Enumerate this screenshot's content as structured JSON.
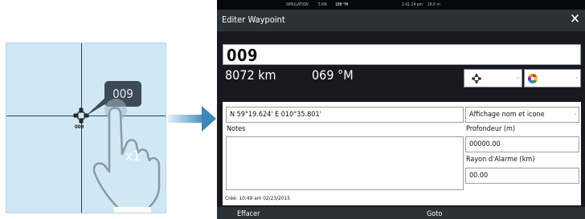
{
  "status_bar": {
    "mode": "SIMULATION",
    "speed": "5 KN",
    "heading": "188 °M",
    "time": "2:41:14 pm",
    "depth": "26.6 m"
  },
  "illustration": {
    "waypoint_label": "009",
    "bubble_label": "009",
    "tap_count": "x1"
  },
  "dialog": {
    "title": "Editer Waypoint",
    "close_glyph": "✕",
    "name": "009",
    "distance": "8072 km",
    "bearing": "069 °M",
    "symbol_dropdown": {
      "icon": "waypoint-cross-icon",
      "selected": ""
    },
    "color_dropdown": {
      "icon": "color-wheel-icon",
      "selected": ""
    },
    "position": "N 59°19.624'  E 010°35.801'",
    "display_mode": "Affichage nom et icone",
    "notes_label": "Notes",
    "notes_value": "",
    "depth_label": "Profondeur (m)",
    "depth_value": "00000.00",
    "alarm_label": "Rayon d'Alarme (km)",
    "alarm_value": "00.00",
    "created": "Créé: 10:49 am  02/23/2015",
    "delete_button": "Effacer",
    "goto_button": "Goto"
  },
  "colors": {
    "dialog_bg": "#161a1e",
    "title_bar": "#2c3136",
    "arrow": "#3d87b7",
    "map_water": "#cfe8f6"
  }
}
